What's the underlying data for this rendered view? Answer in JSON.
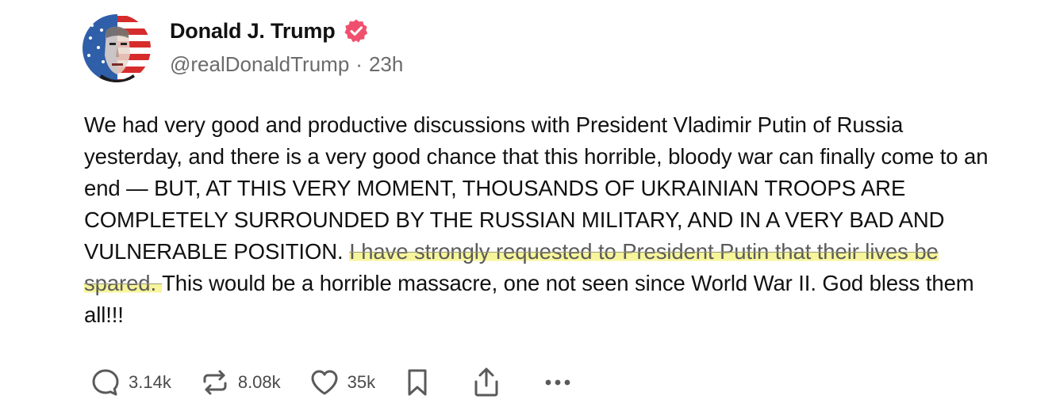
{
  "author": {
    "display_name": "Donald J. Trump",
    "handle": "@realDonaldTrump",
    "separator": "·",
    "time_ago": "23h",
    "verified_color": "#f0506e"
  },
  "post": {
    "text_before": "We had very good and productive discussions with President Vladimir Putin of Russia yesterday, and there is a very good chance that this horrible, bloody war can finally come to an end — BUT, AT THIS VERY MOMENT, THOUSANDS OF UKRAINIAN TROOPS ARE COMPLETELY SURROUNDED BY THE RUSSIAN MILITARY, AND IN A VERY BAD AND VULNERABLE POSITION. ",
    "text_highlighted": "I have strongly requested to President Putin that their lives be spared. ",
    "text_after": "This would be a horrible massacre, one not seen since World War II. God bless them all!!!",
    "highlight_color": "#f7f59b"
  },
  "actions": {
    "replies": "3.14k",
    "reposts": "8.08k",
    "likes": "35k",
    "icons": [
      "reply-icon",
      "repost-icon",
      "heart-icon",
      "bookmark-icon",
      "share-icon",
      "more-icon"
    ]
  }
}
